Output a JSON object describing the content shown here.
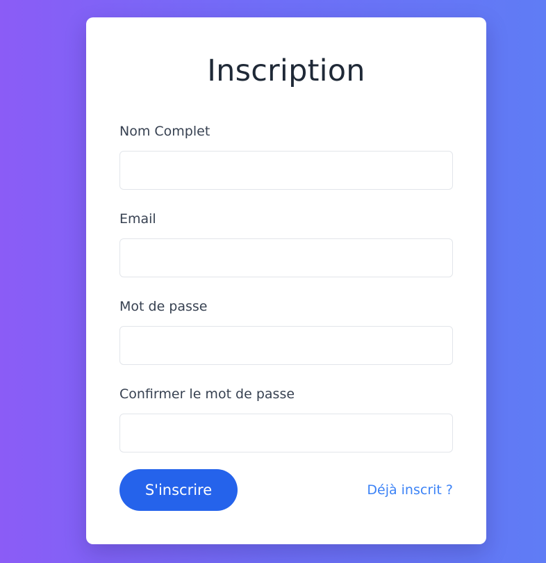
{
  "form": {
    "title": "Inscription",
    "fields": [
      {
        "label": "Nom Complet",
        "value": "",
        "placeholder": ""
      },
      {
        "label": "Email",
        "value": "",
        "placeholder": ""
      },
      {
        "label": "Mot de passe",
        "value": "",
        "placeholder": ""
      },
      {
        "label": "Confirmer le mot de passe",
        "value": "",
        "placeholder": ""
      }
    ],
    "submit_label": "S'inscrire",
    "login_link_label": "Déjà inscrit ?"
  },
  "colors": {
    "background_start": "#8b5cf6",
    "background_end": "#5f7cf5",
    "primary": "#2563eb",
    "link": "#3b82f6",
    "title": "#1f2937",
    "label": "#374151"
  }
}
